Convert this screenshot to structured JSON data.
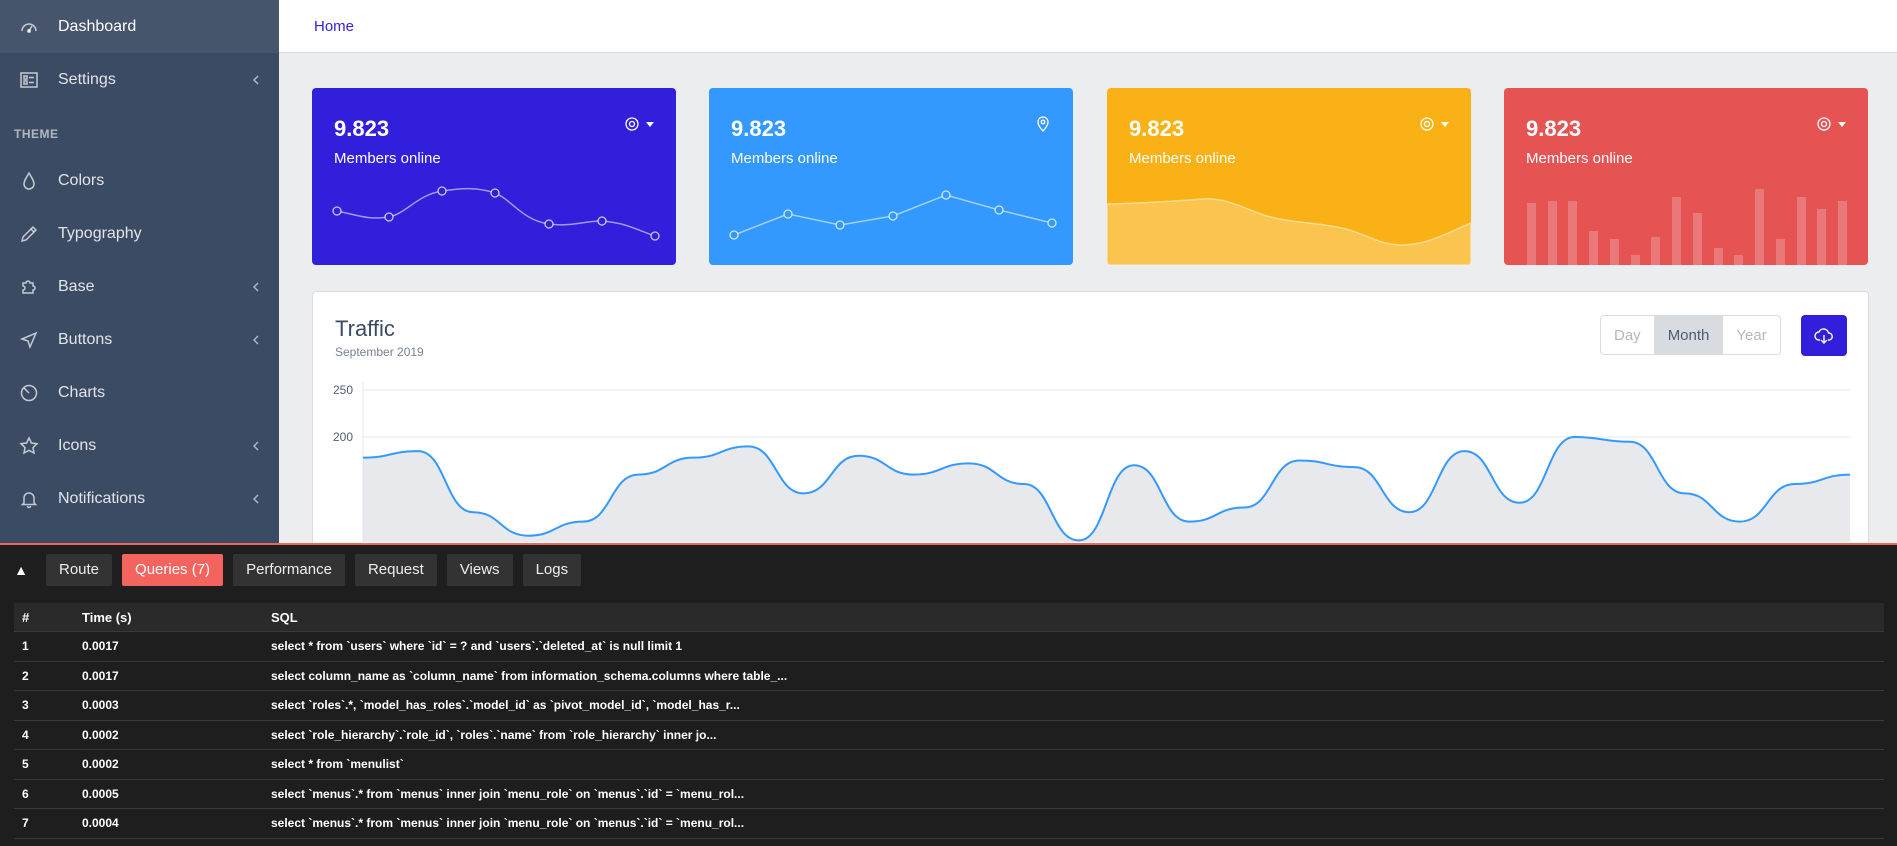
{
  "sidebar": {
    "items": [
      {
        "label": "Dashboard",
        "icon": "speedometer-icon",
        "active": true,
        "has_children": false
      },
      {
        "label": "Settings",
        "icon": "list-rich-icon",
        "active": false,
        "has_children": true
      }
    ],
    "section_title": "THEME",
    "theme_items": [
      {
        "label": "Colors",
        "icon": "drop-icon",
        "has_children": false
      },
      {
        "label": "Typography",
        "icon": "pencil-icon",
        "has_children": false
      },
      {
        "label": "Base",
        "icon": "puzzle-icon",
        "has_children": true
      },
      {
        "label": "Buttons",
        "icon": "cursor-icon",
        "has_children": true
      },
      {
        "label": "Charts",
        "icon": "chart-pie-icon",
        "has_children": false
      },
      {
        "label": "Icons",
        "icon": "star-icon",
        "has_children": true
      },
      {
        "label": "Notifications",
        "icon": "bell-icon",
        "has_children": true
      }
    ]
  },
  "header": {
    "breadcrumb": "Home"
  },
  "widgets": [
    {
      "value": "9.823",
      "label": "Members online",
      "color": "#321fdb",
      "control": "gear-icon"
    },
    {
      "value": "9.823",
      "label": "Members online",
      "color": "#39f",
      "control": "location-pin-icon"
    },
    {
      "value": "9.823",
      "label": "Members online",
      "color": "#f9b115",
      "control": "gear-icon"
    },
    {
      "value": "9.823",
      "label": "Members online",
      "color": "#e55353",
      "control": "gear-icon"
    }
  ],
  "traffic": {
    "title": "Traffic",
    "subtitle": "September 2019",
    "range_buttons": [
      "Day",
      "Month",
      "Year"
    ],
    "active_range": "Month",
    "download_icon": "cloud-download-icon"
  },
  "chart_data": {
    "type": "area",
    "title": "Traffic",
    "subtitle": "September 2019",
    "yticks": [
      "250",
      "200"
    ],
    "ylim": [
      0,
      250
    ],
    "grid": true,
    "series": [
      {
        "color": "#39f",
        "x": [
          0,
          1,
          2,
          3,
          4,
          5,
          6,
          7,
          8,
          9,
          10,
          11,
          12,
          13,
          14,
          15,
          16,
          17,
          18,
          19,
          20,
          21,
          22,
          23,
          24,
          25,
          26,
          27
        ],
        "values": [
          178,
          185,
          120,
          95,
          110,
          160,
          178,
          190,
          140,
          180,
          160,
          172,
          150,
          90,
          170,
          110,
          125,
          175,
          168,
          120,
          185,
          130,
          200,
          195,
          140,
          110,
          150,
          160
        ]
      }
    ]
  },
  "debugbar": {
    "toggle": "▲",
    "tabs": [
      "Route",
      "Queries (7)",
      "Performance",
      "Request",
      "Views",
      "Logs"
    ],
    "active_tab": "Queries (7)",
    "columns": [
      "#",
      "Time (s)",
      "SQL"
    ],
    "rows": [
      {
        "n": "1",
        "time": "0.0017",
        "sql": "select * from `users` where `id` = ? and `users`.`deleted_at` is null limit 1"
      },
      {
        "n": "2",
        "time": "0.0017",
        "sql": "select column_name as `column_name` from information_schema.columns where table_..."
      },
      {
        "n": "3",
        "time": "0.0003",
        "sql": "select `roles`.*, `model_has_roles`.`model_id` as `pivot_model_id`, `model_has_r..."
      },
      {
        "n": "4",
        "time": "0.0002",
        "sql": "select `role_hierarchy`.`role_id`, `roles`.`name` from `role_hierarchy` inner jo..."
      },
      {
        "n": "5",
        "time": "0.0002",
        "sql": "select * from `menulist`"
      },
      {
        "n": "6",
        "time": "0.0005",
        "sql": "select `menus`.* from `menus` inner join `menu_role` on `menus`.`id` = `menu_rol..."
      },
      {
        "n": "7",
        "time": "0.0004",
        "sql": "select `menus`.* from `menus` inner join `menu_role` on `menus`.`id` = `menu_rol..."
      }
    ]
  }
}
